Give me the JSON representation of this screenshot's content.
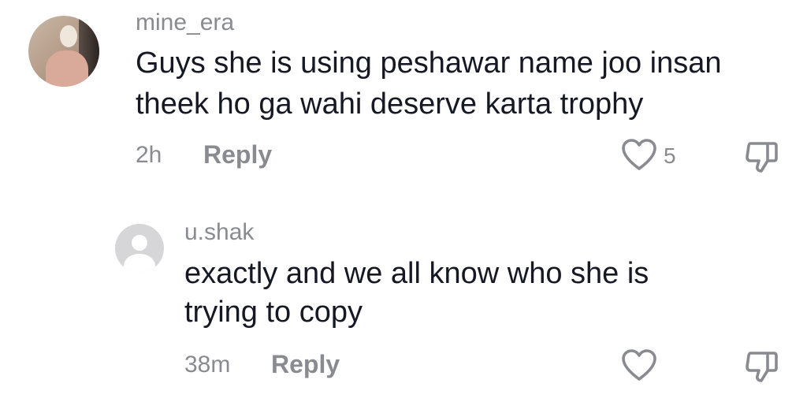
{
  "comments": [
    {
      "username": "mine_era",
      "text_line1": "Guys she is using peshawar name joo insan",
      "text_line2": "theek ho ga wahi deserve karta trophy",
      "time": "2h",
      "reply_label": "Reply",
      "like_count": "5",
      "avatar_icon": "user-photo-avatar",
      "like_icon": "heart-outline-icon",
      "dislike_icon": "thumbs-down-icon"
    },
    {
      "username": "u.shak",
      "text_line1": "exactly and we all know who she is",
      "text_line2": "trying to copy",
      "time": "38m",
      "reply_label": "Reply",
      "like_count": "",
      "avatar_icon": "default-avatar",
      "like_icon": "heart-outline-icon",
      "dislike_icon": "thumbs-down-icon"
    }
  ],
  "colors": {
    "text_primary": "#161823",
    "text_secondary": "#8a8b91",
    "icon": "#8a8b91",
    "background": "#ffffff"
  }
}
